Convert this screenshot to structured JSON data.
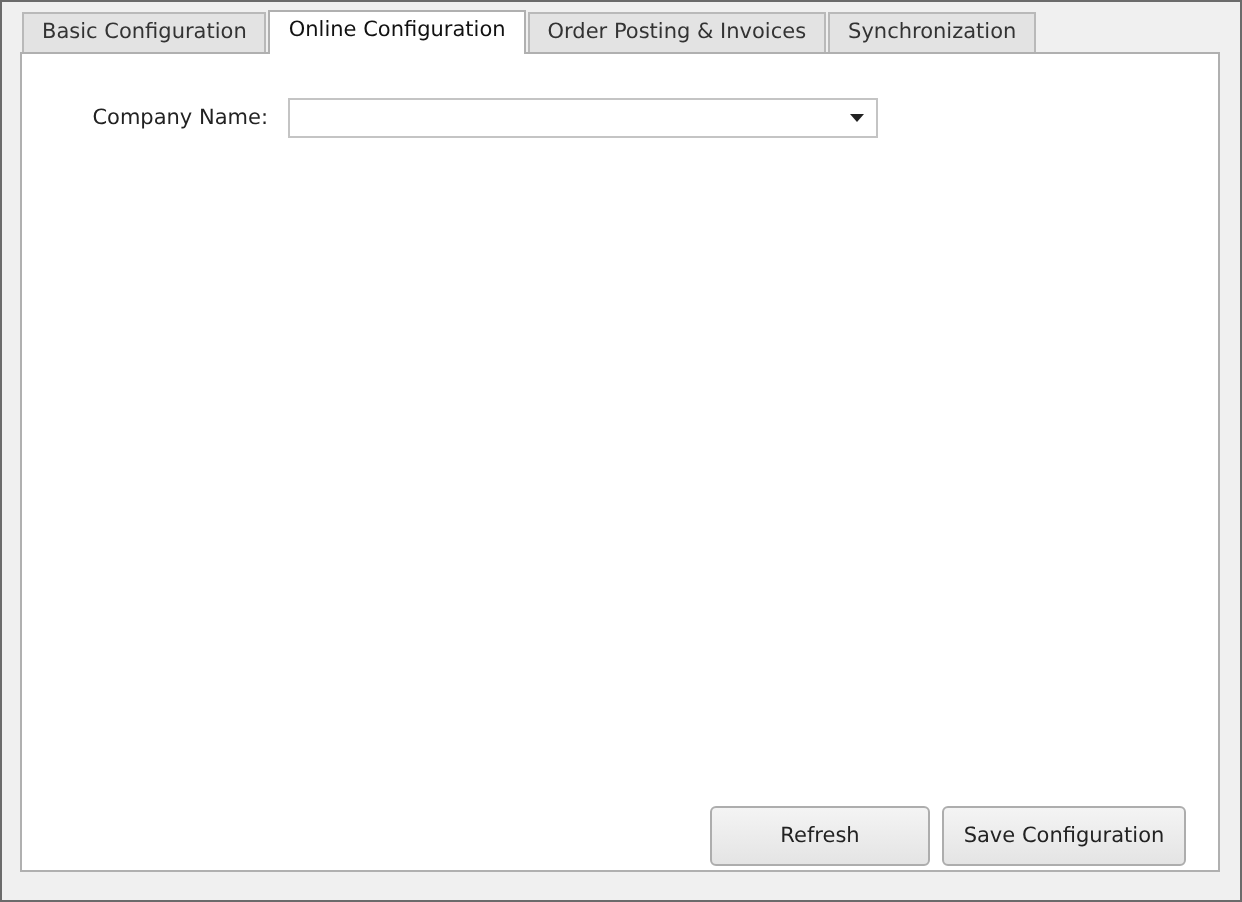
{
  "tabs": [
    {
      "label": "Basic Configuration",
      "selected": false
    },
    {
      "label": "Online Configuration",
      "selected": true
    },
    {
      "label": "Order Posting & Invoices",
      "selected": false
    },
    {
      "label": "Synchronization",
      "selected": false
    }
  ],
  "company_name": {
    "label": "Company Name:"
  },
  "buttons": [
    "Refresh",
    "Save Configuration"
  ]
}
